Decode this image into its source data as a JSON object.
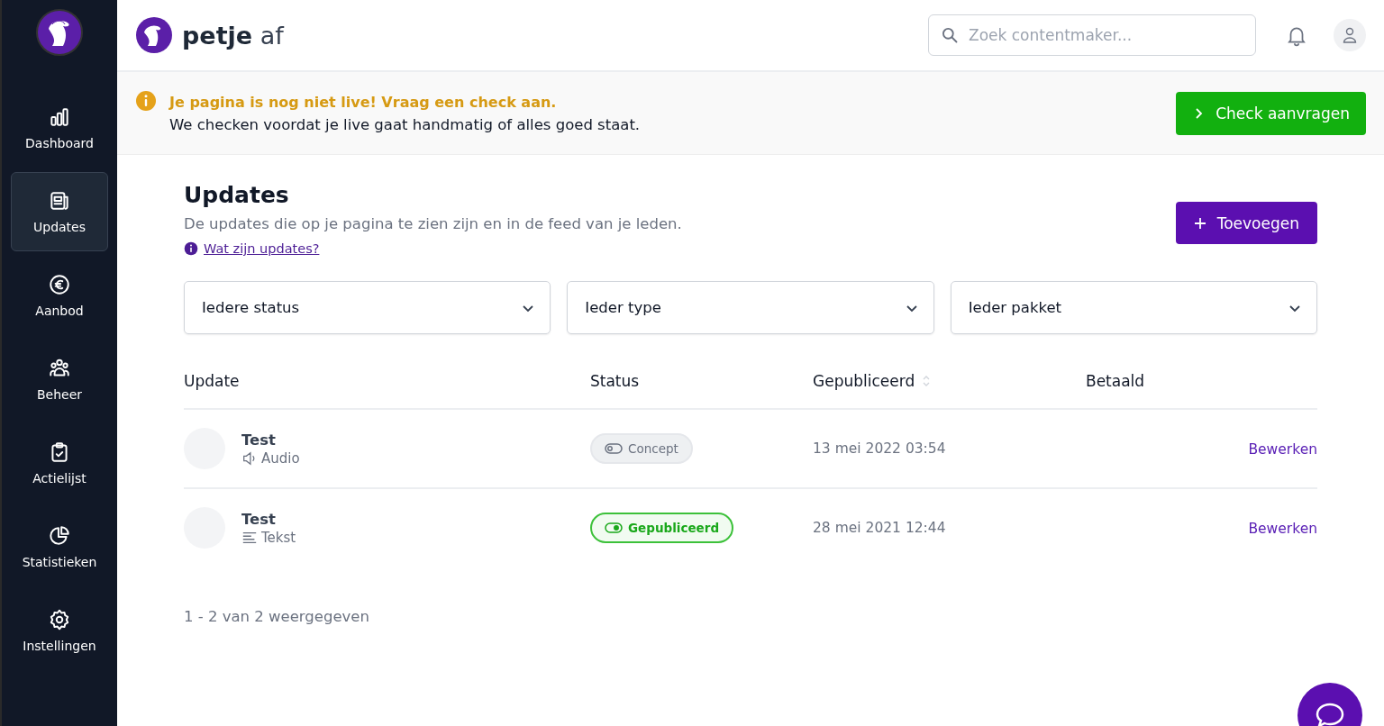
{
  "sidebar": {
    "items": [
      {
        "kind": "dashboard",
        "label": "Dashboard",
        "selected": false
      },
      {
        "kind": "updates",
        "label": "Updates",
        "selected": true
      },
      {
        "kind": "offer",
        "label": "Aanbod",
        "selected": false
      },
      {
        "kind": "manage",
        "label": "Beheer",
        "selected": false
      },
      {
        "kind": "actions",
        "label": "Actielijst",
        "selected": false
      },
      {
        "kind": "stats",
        "label": "Statistieken",
        "selected": false
      },
      {
        "kind": "settings",
        "label": "Instellingen",
        "selected": false
      }
    ]
  },
  "header": {
    "brand_bold": "petje",
    "brand_light": "af",
    "search": {
      "placeholder": "Zoek contentmaker..."
    }
  },
  "banner": {
    "title": "Je pagina is nog niet live! Vraag een check aan.",
    "text": "We checken voordat je live gaat handmatig of alles goed staat.",
    "button": "Check aanvragen"
  },
  "page": {
    "title": "Updates",
    "subtitle": "De updates die op je pagina te zien zijn en in de feed van je leden.",
    "help_link": "Wat zijn updates?",
    "add_button": "Toevoegen"
  },
  "filters": [
    {
      "value": "Iedere status"
    },
    {
      "value": "Ieder type"
    },
    {
      "value": "Ieder pakket"
    }
  ],
  "table": {
    "columns": [
      "Update",
      "Status",
      "Gepubliceerd",
      "Betaald"
    ],
    "rows": [
      {
        "title": "Test",
        "type": {
          "kind": "audio",
          "label": "Audio"
        },
        "status": {
          "kind": "concept",
          "label": "Concept"
        },
        "published": "13 mei 2022 03:54",
        "action": "Bewerken"
      },
      {
        "title": "Test",
        "type": {
          "kind": "text",
          "label": "Tekst"
        },
        "status": {
          "kind": "published",
          "label": "Gepubliceerd"
        },
        "published": "28 mei 2021 12:44",
        "action": "Bewerken"
      }
    ]
  },
  "pagination": "1 - 2 van 2 weergegeven"
}
